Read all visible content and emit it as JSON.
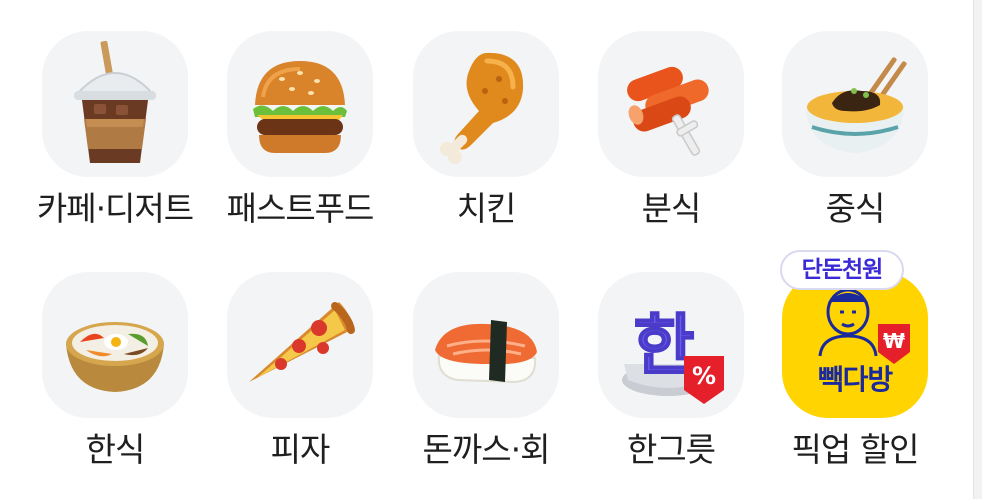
{
  "categories": [
    {
      "label": "카페·디저트",
      "icon": "coffee-cup-icon"
    },
    {
      "label": "패스트푸드",
      "icon": "burger-icon"
    },
    {
      "label": "치킨",
      "icon": "chicken-leg-icon"
    },
    {
      "label": "분식",
      "icon": "tteokbokki-icon"
    },
    {
      "label": "중식",
      "icon": "jajangmyeon-icon"
    },
    {
      "label": "한식",
      "icon": "bibimbap-icon"
    },
    {
      "label": "피자",
      "icon": "pizza-slice-icon"
    },
    {
      "label": "돈까스·회",
      "icon": "sushi-icon"
    },
    {
      "label": "한그릇",
      "icon": "han-discount-icon",
      "icon_text": "한",
      "icon_badge": "%"
    },
    {
      "label": "픽업 할인",
      "icon": "paik-dabang-logo",
      "badge": "단돈천원",
      "icon_text": "빽다방",
      "icon_badge": "₩"
    }
  ],
  "colors": {
    "tile_background": "#f3f4f6",
    "label_text": "#1f1f1f",
    "badge_text": "#3b2bd6",
    "paik_yellow": "#ffd400",
    "paik_text": "#1a2a9c",
    "discount_red": "#e5202b",
    "han_purple": "#6b5bf0"
  }
}
